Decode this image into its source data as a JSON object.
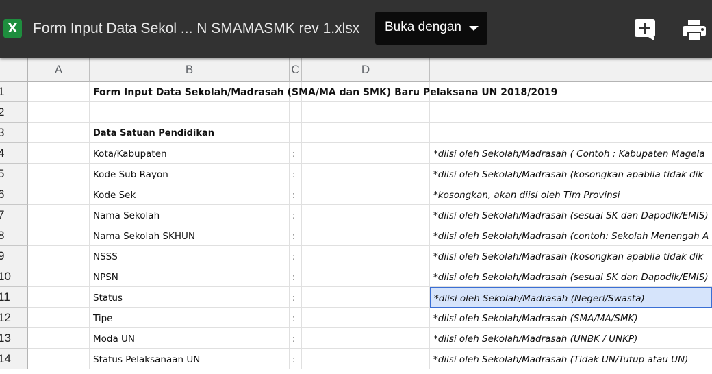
{
  "topbar": {
    "file_icon": "excel-file-icon",
    "file_icon_letter": "X",
    "file_title": "Form Input Data Sekol ... N SMAMASMK rev 1.xlsx",
    "open_with_label": "Buka dengan",
    "add_icon": "add-to-drive-icon",
    "print_icon": "printer-icon"
  },
  "columns": [
    "A",
    "B",
    "C",
    "D"
  ],
  "rows": [
    {
      "num": "1",
      "b": "Form Input Data Sekolah/Madrasah (SMA/MA dan SMK) Baru Pelaksana UN 2018/2019",
      "c": "",
      "e": ""
    },
    {
      "num": "2",
      "b": "",
      "c": "",
      "e": ""
    },
    {
      "num": "3",
      "b": "Data Satuan Pendidikan",
      "c": "",
      "e": ""
    },
    {
      "num": "4",
      "b": "Kota/Kabupaten",
      "c": ":",
      "e": "*diisi oleh Sekolah/Madrasah ( Contoh : Kabupaten Magela"
    },
    {
      "num": "5",
      "b": "Kode Sub Rayon",
      "c": ":",
      "e": "*diisi oleh Sekolah/Madrasah (kosongkan apabila tidak dik"
    },
    {
      "num": "6",
      "b": "Kode Sek",
      "c": ":",
      "e": "*kosongkan, akan diisi oleh Tim Provinsi"
    },
    {
      "num": "7",
      "b": "Nama Sekolah",
      "c": ":",
      "e": "*diisi oleh Sekolah/Madrasah (sesuai SK dan Dapodik/EMIS)"
    },
    {
      "num": "8",
      "b": "Nama Sekolah SKHUN",
      "c": ":",
      "e": "*diisi oleh Sekolah/Madrasah (contoh: Sekolah Menengah A"
    },
    {
      "num": "9",
      "b": "NSSS",
      "c": ":",
      "e": "*diisi oleh Sekolah/Madrasah (kosongkan apabila tidak dik"
    },
    {
      "num": "10",
      "b": "NPSN",
      "c": ":",
      "e": "*diisi oleh Sekolah/Madrasah (sesuai SK dan Dapodik/EMIS)"
    },
    {
      "num": "11",
      "b": "Status",
      "c": ":",
      "e": "*diisi oleh Sekolah/Madrasah (Negeri/Swasta)"
    },
    {
      "num": "12",
      "b": "Tipe",
      "c": ":",
      "e": "*diisi oleh Sekolah/Madrasah (SMA/MA/SMK)"
    },
    {
      "num": "13",
      "b": "Moda UN",
      "c": ":",
      "e": "*diisi oleh Sekolah/Madrasah (UNBK / UNKP)"
    },
    {
      "num": "14",
      "b": "Status Pelaksanaan UN",
      "c": ":",
      "e": "*diisi oleh Sekolah/Madrasah (Tidak UN/Tutup atau UN)"
    }
  ],
  "selected_row": "11",
  "colors": {
    "topbar": "#323232",
    "excel_green": "#1e8e3e",
    "selection": "#d6e4fb",
    "selection_border": "#3b6fd4"
  }
}
